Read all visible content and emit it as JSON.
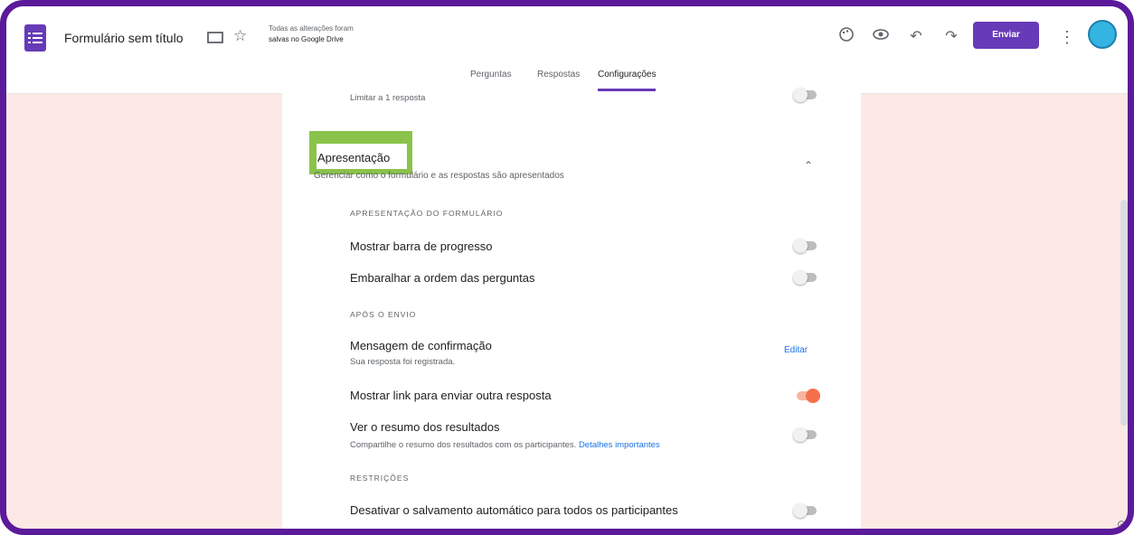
{
  "header": {
    "form_title": "Formulário sem título",
    "save_line1": "Todas as alterações foram",
    "save_line2": "salvas no Google Drive",
    "send_label": "Enviar",
    "icons": [
      "palette-icon",
      "preview-icon",
      "undo-icon",
      "redo-icon",
      "more-icon"
    ]
  },
  "tabs": [
    "Perguntas",
    "Respostas",
    "Configurações"
  ],
  "active_tab": "Configurações",
  "colors": {
    "accent": "#673ab7",
    "highlight": "#8bc34a",
    "toggle_on": "#f4704b",
    "page_bg": "#fce9e5",
    "frame": "#5b1a9a"
  },
  "settings": {
    "top_partial_label": "Limitar a 1 resposta",
    "presentation": {
      "title": "Apresentação",
      "description": "Gerenciar como o formulário e as respostas são apresentados",
      "form_caption": "APRESENTAÇÃO DO FORMULÁRIO",
      "progress_bar_label": "Mostrar barra de progresso",
      "progress_bar_on": false,
      "shuffle_label": "Embaralhar a ordem das perguntas",
      "shuffle_on": false,
      "after_send_caption": "APÓS O ENVIO",
      "confirmation_label": "Mensagem de confirmação",
      "confirmation_value": "Sua resposta foi registrada.",
      "edit_label": "Editar",
      "show_link_label": "Mostrar link para enviar outra resposta",
      "show_link_on": true,
      "summary_label": "Ver o resumo dos resultados",
      "summary_desc": "Compartilhe o resumo dos resultados com os participantes.",
      "summary_link": "Detalhes importantes",
      "summary_on": false,
      "restrictions_caption": "RESTRIÇÕES",
      "autosave_label": "Desativar o salvamento automático para todos os participantes",
      "autosave_on": false
    }
  }
}
